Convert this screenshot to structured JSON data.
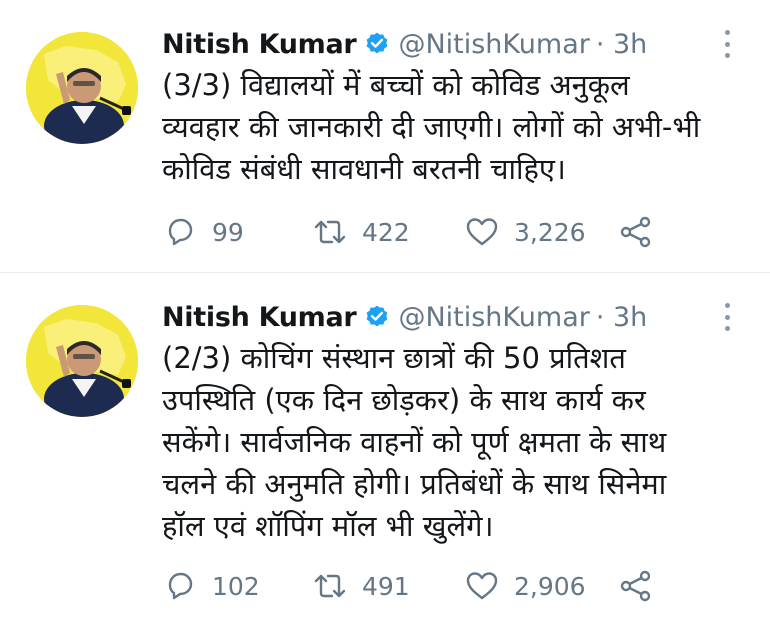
{
  "tweets": [
    {
      "author": {
        "name": "Nitish Kumar",
        "handle": "@NitishKumar",
        "time": "· 3h",
        "verified": true
      },
      "text_lines": [
        "(3/3) विद्यालयों में बच्चों को कोविड अनुकूल",
        "व्यवहार की जानकारी दी जाएगी। लोगों को अभी-भी",
        "कोविड संबंधी सावधानी बरतनी चाहिए।"
      ],
      "actions": {
        "replies": "99",
        "retweets": "422",
        "likes": "3,226"
      }
    },
    {
      "author": {
        "name": "Nitish Kumar",
        "handle": "@NitishKumar",
        "time": "· 3h",
        "verified": true
      },
      "text_lines": [
        "(2/3) कोचिंग संस्थान छात्रों की 50 प्रतिशत",
        "उपस्थिति (एक दिन छोड़कर) के साथ कार्य कर",
        "सकेंगे। सार्वजनिक वाहनों को पूर्ण क्षमता के साथ",
        "चलने की अनुमति होगी। प्रतिबंधों के साथ सिनेमा",
        "हॉल एवं शॉपिंग मॉल भी खुलेंगे।"
      ],
      "actions": {
        "replies": "102",
        "retweets": "491",
        "likes": "2,906"
      }
    }
  ],
  "icons": {
    "verified": "verified-badge-icon",
    "reply": "reply-icon",
    "retweet": "retweet-icon",
    "like": "heart-icon",
    "share": "share-icon",
    "more": "more-vertical-icon"
  },
  "colors": {
    "accent": "#1da1f2",
    "text": "#14171a",
    "secondary": "#657786",
    "avatar_background": "#f2e63a"
  }
}
